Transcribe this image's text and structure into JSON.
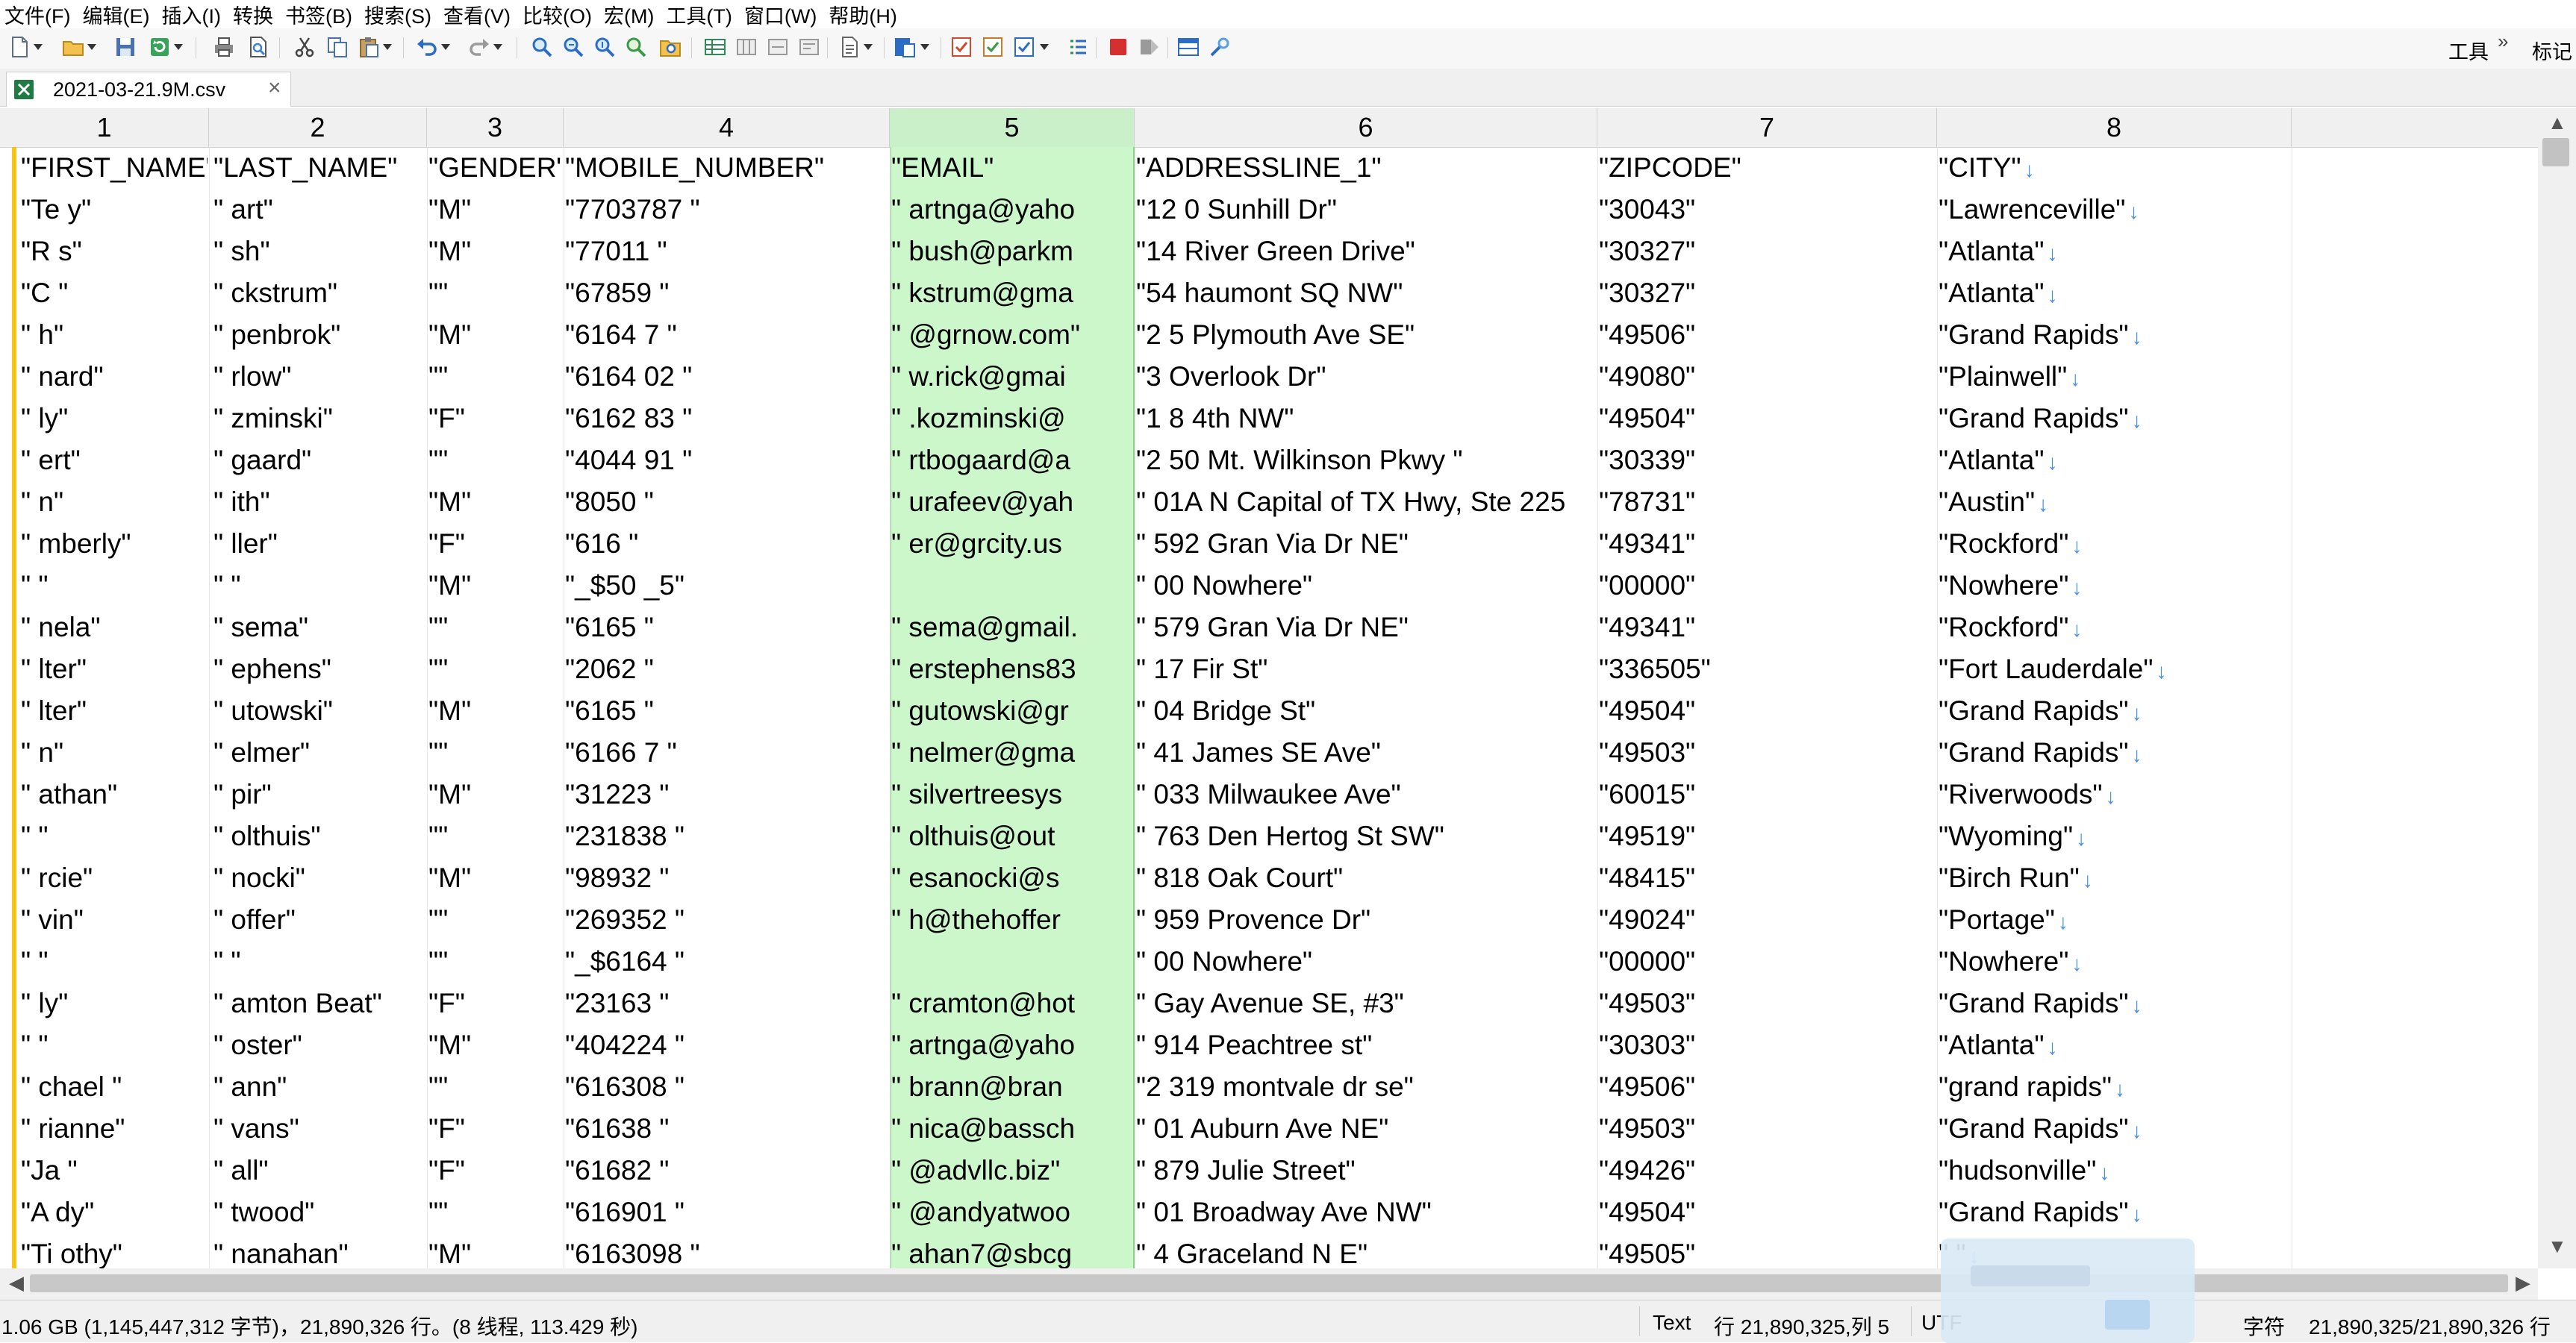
{
  "menu": [
    "文件(F)",
    "编辑(E)",
    "插入(I)",
    "转换",
    "书签(B)",
    "搜索(S)",
    "查看(V)",
    "比较(O)",
    "宏(M)",
    "工具(T)",
    "窗口(W)",
    "帮助(H)"
  ],
  "toolbar": {
    "tools_label": "工具",
    "more": "»",
    "bookmarks_label": "标记"
  },
  "tab": {
    "label": "2021-03-21.9M.csv",
    "close": "×"
  },
  "columns": [
    "1",
    "2",
    "3",
    "4",
    "5",
    "6",
    "7",
    "8"
  ],
  "selected_column": "5",
  "eol_marker": "↓",
  "rows": [
    [
      "\"FIRST_NAME\"",
      "\"LAST_NAME\"",
      "\"GENDER\"",
      "\"MOBILE_NUMBER\"",
      "\"EMAIL\"",
      "\"ADDRESSLINE_1\"",
      "\"ZIPCODE\"",
      "\"CITY\""
    ],
    [
      "\"Te  y\"",
      "\"   art\"",
      "\"M\"",
      "\"7703787    \"",
      "\"    artnga@yaho",
      "\"12  0 Sunhill Dr\"",
      "\"30043\"",
      "\"Lawrenceville\""
    ],
    [
      "\"R   s\"",
      "\"   sh\"",
      "\"M\"",
      "\"77011       \"",
      "\"      bush@parkm",
      "\"14   River Green Drive\"",
      "\"30327\"",
      "\"Atlanta\""
    ],
    [
      "\"C    \"",
      "\"   ckstrum\"",
      "\"\"",
      "\"67859       \"",
      "\"      kstrum@gma",
      "\"54   haumont SQ NW\"",
      "\"30327\"",
      "\"Atlanta\""
    ],
    [
      "\"   h\"",
      "\"   penbrok\"",
      "\"M\"",
      "\"6164   7    \"",
      "\"     @grnow.com\"",
      "\"2   5 Plymouth Ave SE\"",
      "\"49506\"",
      "\"Grand Rapids\""
    ],
    [
      "\"   nard\"",
      "\"   rlow\"",
      "\"\"",
      "\"6164  02    \"",
      "\"     w.rick@gmai",
      "\"3   Overlook Dr\"",
      "\"49080\"",
      "\"Plainwell\""
    ],
    [
      "\"   ly\"",
      "\"   zminski\"",
      "\"F\"",
      "\"6162  83    \"",
      "\"     .kozminski@",
      "\"1   8 4th NW\"",
      "\"49504\"",
      "\"Grand Rapids\""
    ],
    [
      "\"   ert\"",
      "\"   gaard\"",
      "\"\"",
      "\"4044  91    \"",
      "\"     rtbogaard@a",
      "\"2   50 Mt. Wilkinson Pkwy \"",
      "\"30339\"",
      "\"Atlanta\""
    ],
    [
      "\"   n\"",
      "\"   ith\"",
      "\"M\"",
      "\"8050         \"",
      "\"     urafeev@yah",
      "\"   01A N Capital of TX Hwy, Ste 225",
      "\"78731\"",
      "\"Austin\""
    ],
    [
      "\"   mberly\"",
      "\"   ller\"",
      "\"F\"",
      "\"616          \"",
      "\"     er@grcity.us",
      "\"  592 Gran Via Dr NE\"",
      "\"49341\"",
      "\"Rockford\""
    ],
    [
      "\"  \"",
      "\"  \"",
      "\"M\"",
      "\"_$50           _5\"",
      "",
      "\"  00 Nowhere\"",
      "\"00000\"",
      "\"Nowhere\""
    ],
    [
      "\"   nela\"",
      "\"   sema\"",
      "\"\"",
      "\"6165          \"",
      "\"     sema@gmail.",
      "\"  579 Gran Via Dr NE\"",
      "\"49341\"",
      "\"Rockford\""
    ],
    [
      "\"   lter\"",
      "\"   ephens\"",
      "\"\"",
      "\"2062          \"",
      "\"     erstephens83",
      "\"  17 Fir St\"",
      "\"336505\"",
      "\"Fort Lauderdale\""
    ],
    [
      "\"   lter\"",
      "\"   utowski\"",
      "\"M\"",
      "\"6165          \"",
      "\"     gutowski@gr",
      "\"  04 Bridge St\"",
      "\"49504\"",
      "\"Grand Rapids\""
    ],
    [
      "\"   n\"",
      "\"   elmer\"",
      "\"\"",
      "\"6166  7       \"",
      "\"     nelmer@gma",
      "\"  41 James SE Ave\"",
      "\"49503\"",
      "\"Grand Rapids\""
    ],
    [
      "\"   athan\"",
      "\"   pir\"",
      "\"M\"",
      "\"31223         \"",
      "\"     silvertreesys",
      "\"  033 Milwaukee Ave\"",
      "\"60015\"",
      "\"Riverwoods\""
    ],
    [
      "\"   \"",
      "\"   olthuis\"",
      "\"\"",
      "\"231838        \"",
      "\"     olthuis@out",
      "\"  763 Den Hertog St SW\"",
      "\"49519\"",
      "\"Wyoming\""
    ],
    [
      "\"   rcie\"",
      "\"   nocki\"",
      "\"M\"",
      "\"98932         \"",
      "\"     esanocki@s",
      "\"  818 Oak Court\"",
      "\"48415\"",
      "\"Birch Run\""
    ],
    [
      "\"   vin\"",
      "\"   offer\"",
      "\"\"",
      "\"269352        \"",
      "\"     h@thehoffer",
      "\"  959 Provence Dr\"",
      "\"49024\"",
      "\"Portage\""
    ],
    [
      "\"  \"",
      "\"  \"",
      "\"\"",
      "\"_$6164          \"",
      "",
      "\"  00 Nowhere\"",
      "\"00000\"",
      "\"Nowhere\""
    ],
    [
      "\"   ly\"",
      "\"   amton Beat\"",
      "\"F\"",
      "\"23163         \"",
      "\"     cramton@hot",
      "\"   Gay Avenue SE, #3\"",
      "\"49503\"",
      "\"Grand Rapids\""
    ],
    [
      "\"   \"",
      "\"   oster\"",
      "\"M\"",
      "\"404224        \"",
      "\"     artnga@yaho",
      "\"  914 Peachtree st\"",
      "\"30303\"",
      "\"Atlanta\""
    ],
    [
      "\"   chael \"",
      "\"   ann\"",
      "\"\"",
      "\"616308        \"",
      "\"     brann@bran",
      "\"2  319 montvale dr se\"",
      "\"49506\"",
      "\"grand rapids\""
    ],
    [
      "\"   rianne\"",
      "\"   vans\"",
      "\"F\"",
      "\"61638         \"",
      "\"     nica@bassch",
      "\"  01 Auburn Ave NE\"",
      "\"49503\"",
      "\"Grand Rapids\""
    ],
    [
      "\"Ja   \"",
      "\"   all\"",
      "\"F\"",
      "\"61682         \"",
      "\"     @advllc.biz\"",
      "\"  879 Julie Street\"",
      "\"49426\"",
      "\"hudsonville\""
    ],
    [
      "\"A  dy\"",
      "\"   twood\"",
      "\"\"",
      "\"616901        \"",
      "\"     @andyatwoo",
      "\"  01 Broadway Ave NW\"",
      "\"49504\"",
      "\"Grand Rapids\""
    ],
    [
      "\"Ti  othy\"",
      "\"   nanahan\"",
      "\"M\"",
      "\"6163098      \"",
      "\"     ahan7@sbcg",
      "\"  4 Graceland N E\"",
      "\"49505\"",
      "\"   \""
    ]
  ],
  "status": {
    "file_info": "1.06 GB (1,145,447,312 字节)，21,890,326 行。(8 线程, 113.429 秒)",
    "mode": "Text",
    "position": "行 21,890,325,列 5",
    "encoding": "UTF",
    "count_suffix": "字符",
    "selection": "21,890,325/21,890,326 行"
  },
  "colors": {
    "selected_column_bg": "#ccf7cb",
    "row_marker": "#f5c518",
    "eol_arrow": "#3f90e6"
  }
}
